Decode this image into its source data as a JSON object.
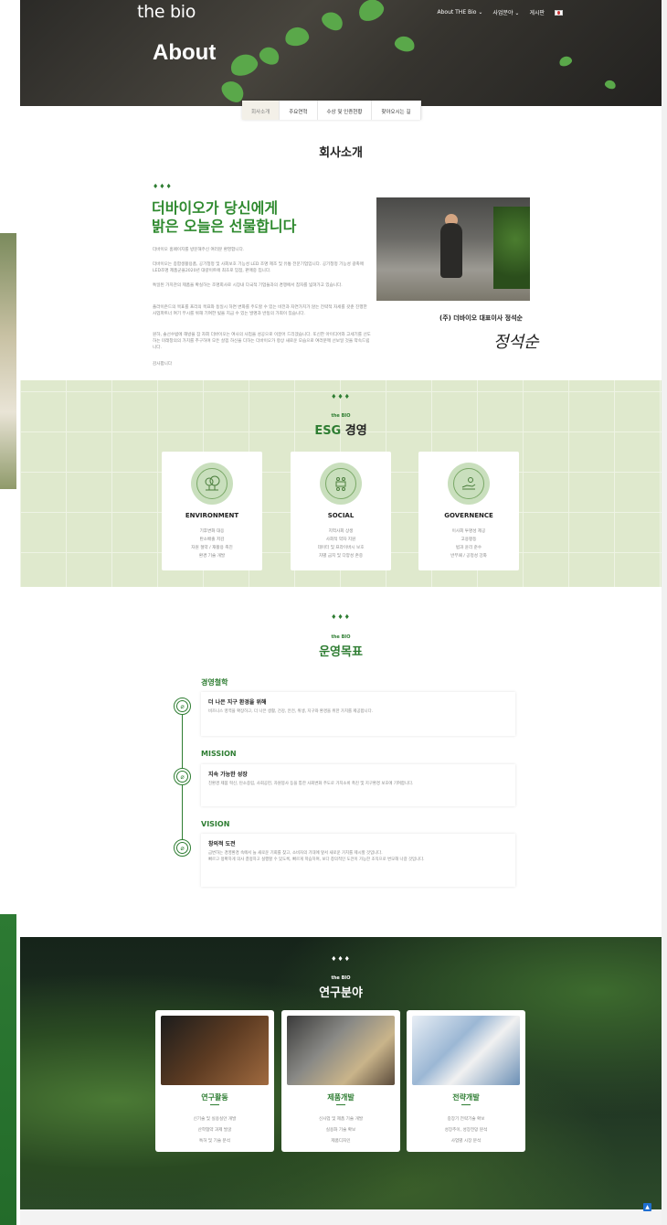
{
  "header": {
    "logo": "the bio",
    "nav": [
      "About THE Bio ⌄",
      "사업분야 ⌄",
      "게시판"
    ],
    "page_title": "About"
  },
  "tabs": [
    {
      "label": "회사소개",
      "active": true
    },
    {
      "label": "주요연혁"
    },
    {
      "label": "수상 및 인증현황"
    },
    {
      "label": "찾아오시는 길"
    }
  ],
  "intro": {
    "section_title": "회사소개",
    "leaves": "♦♦♦",
    "headline_1": "더바이오가 당신에게",
    "headline_2": "밝은 오늘은 선물합니다",
    "paragraphs": [
      "더바이오 홈페이지를 방문해주신 여러분 환영합니다.",
      "더바이오는 종합생활용품, 공기청정 및 사회보호 기능성 LED 조명 제조 및 유통 전문기업입니다. 공기청정 기능성 광촉매 LED조명 제품군을2020년 대량이트에 최초로 입점, 판매중 입니다.",
      "특일된 가치관의 제품을 확실하는 조명회사로 시장내 다국적 기업들과의 경쟁에서 참자를 넓혀가고 있습니다.",
      "플라이즌드의 목표를 프리의 목표와 동일시 하면 변화를 주도할 수 있는 비전과 자연가치가 않는 전략적 자세를 갖춘 진행한 사업파트너 여기 무시를 위해 기여한 빛을 지금 수 있는 발명과 반동의 가죄이 있습니다.",
      "원하, 솔선수범에 해방을 잠 자회 더바이오는 여사의 사업을 성공으로 이끌어 드리겠습니다. 또신한 아이디어와 고세기를 선도하는 미래창의의 가치를 추구하며 모든 살핌 하신을 다하는 더바이오가 항상 새로운 모습으로 여러분께 선보일 것을 약속드립니다.",
      "감사합니다"
    ],
    "ceo_caption": "(주) 더바이오 대표이사 정석순",
    "signature": "정석순"
  },
  "esg": {
    "leaves": "♦♦♦",
    "sub": "the BIO",
    "title_en": "ESG",
    "title_ko": " 경영",
    "cards": [
      {
        "icon": "tree-icon",
        "title": "ENVIRONMENT",
        "items": [
          "기후변화 대응",
          "탄소배출 저감",
          "자원 절약 / 재활용 촉진",
          "환경 기술 개발"
        ]
      },
      {
        "icon": "people-table-icon",
        "title": "SOCIAL",
        "items": [
          "지역사회 상생",
          "사회적 약자 지원",
          "데이터 및 프라이버시 보호",
          "차별 금지 및 다양성 존중"
        ]
      },
      {
        "icon": "hand-coins-icon",
        "title": "GOVERNENCE",
        "items": [
          "이사회 투명성 제공",
          "고용평등",
          "법과 윤리 준수",
          "반부패 / 공정성 강화"
        ]
      }
    ]
  },
  "goals": {
    "leaves": "♦♦♦",
    "sub": "the BIO",
    "title": "운영목표",
    "items": [
      {
        "heading": "경영철학",
        "title": "더 나은 지구 환경을 위해",
        "body": "비즈니스 영역을 확장하고, 더 나은 생활, 건강, 안전, 위생, 지구와 환경을 위한 가치를 제공합니다."
      },
      {
        "heading": "MISSION",
        "title": "지속 가능한 성장",
        "body": "친환경 제품 혁신, 탄소중립, 사회공헌, 자원봉사 등을 통한 사회변화 주도로 가치소비 촉진 및 지구환경 보호에 기여합니다."
      },
      {
        "heading": "VISION",
        "title": "창의적 도전",
        "body": "급변하는 경영환경 속에서 늘 새로운 기회를 찾고, 소비자의 기대에 앞서 새로운 가치를 제시할 것입니다.",
        "body2": "빠르고 정확하게 의사 결정하고 실행할 수 있도록, 빠르게 학습하며, 보다 창의적인 도전이 가능한 조직으로 변모해 나갈 것입니다."
      }
    ]
  },
  "research": {
    "leaves": "♦♦♦",
    "sub": "the BIO",
    "title": "연구분야",
    "cards": [
      {
        "title": "연구활동",
        "items": [
          "신기술 및 실용실안 개발",
          "산학협약 과제 발굴",
          "특허 및 기술 분석"
        ]
      },
      {
        "title": "제품개발",
        "items": [
          "신사업 및 제품 기술 개발",
          "실용화 기술 확보",
          "제품디자인"
        ]
      },
      {
        "title": "전략개발",
        "items": [
          "중장기 전략기술 확보",
          "성장추이, 성장전망 분석",
          "사업별 시장 분석"
        ]
      }
    ]
  },
  "colors": {
    "brand_green": "#2e7d32",
    "esg_bg": "#dfe9cd"
  }
}
